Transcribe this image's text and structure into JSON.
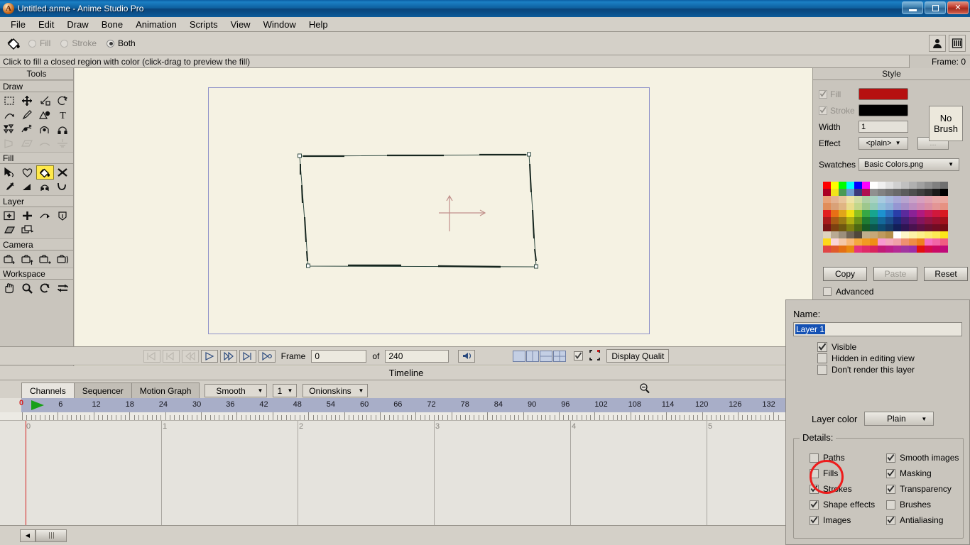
{
  "window": {
    "title": "Untitled.anme - Anime Studio Pro",
    "app_icon": "anime-studio-logo-icon",
    "minimize_label": "minimize-icon",
    "restore_label": "restore-icon",
    "close_label": "✕"
  },
  "menu": {
    "items": [
      "File",
      "Edit",
      "Draw",
      "Bone",
      "Animation",
      "Scripts",
      "View",
      "Window",
      "Help"
    ]
  },
  "modebar": {
    "tool_icon": "paint-bucket-icon",
    "options": [
      {
        "label": "Fill",
        "selected": false,
        "disabled": true
      },
      {
        "label": "Stroke",
        "selected": false,
        "disabled": true
      },
      {
        "label": "Both",
        "selected": true,
        "disabled": false
      }
    ],
    "right_icons": [
      "user-account-icon",
      "content-library-icon"
    ]
  },
  "statusbar": {
    "hint": "Click to fill a closed region with color (click-drag to preview the fill)",
    "frame_indicator": "Frame: 0"
  },
  "tools": {
    "panel_title": "Tools",
    "groups": [
      {
        "name": "Draw",
        "items": [
          {
            "name": "select-points-tool",
            "glyph": "dashed-rect",
            "enabled": true,
            "selected": false
          },
          {
            "name": "transform-points-tool",
            "glyph": "move-arrows",
            "enabled": true,
            "selected": false
          },
          {
            "name": "scale-points-tool",
            "glyph": "scale-box",
            "enabled": true,
            "selected": false
          },
          {
            "name": "rotate-points-tool",
            "glyph": "rotate-arrow",
            "enabled": true,
            "selected": false
          },
          {
            "name": "curvature-tool",
            "glyph": "arc",
            "enabled": true,
            "selected": false
          },
          {
            "name": "add-point-tool",
            "glyph": "pencil",
            "enabled": true,
            "selected": false
          },
          {
            "name": "freehand-tool",
            "glyph": "shape-circle",
            "enabled": true,
            "selected": false
          },
          {
            "name": "text-tool",
            "glyph": "letter-T",
            "enabled": true,
            "selected": false
          },
          {
            "name": "magnet-tool",
            "glyph": "triangles",
            "enabled": true,
            "selected": false
          },
          {
            "name": "noise-tool",
            "glyph": "curve-node",
            "enabled": true,
            "selected": false
          },
          {
            "name": "bind-points-tool",
            "glyph": "arch",
            "enabled": true,
            "selected": false
          },
          {
            "name": "hide-edge-tool",
            "glyph": "magnet",
            "enabled": true,
            "selected": false
          },
          {
            "name": "perspective-points-tool",
            "glyph": "trapezoid",
            "enabled": false,
            "selected": false
          },
          {
            "name": "shear-points-tool",
            "glyph": "shear",
            "enabled": false,
            "selected": false
          },
          {
            "name": "bend-points-tool",
            "glyph": "bend",
            "enabled": false,
            "selected": false
          },
          {
            "name": "reset-tool",
            "glyph": "reset-lines",
            "enabled": false,
            "selected": false
          }
        ]
      },
      {
        "name": "Fill",
        "items": [
          {
            "name": "select-shape-tool",
            "glyph": "arrow-shape",
            "enabled": true,
            "selected": false
          },
          {
            "name": "create-shape-tool",
            "glyph": "blob",
            "enabled": true,
            "selected": false
          },
          {
            "name": "paint-bucket-tool",
            "glyph": "paint-bucket",
            "enabled": true,
            "selected": true
          },
          {
            "name": "delete-shape-tool",
            "glyph": "x-mark",
            "enabled": true,
            "selected": false
          },
          {
            "name": "eyedropper-tool",
            "glyph": "eyedropper",
            "enabled": true,
            "selected": false
          },
          {
            "name": "gradient-tool",
            "glyph": "gradient-wedge",
            "enabled": true,
            "selected": false
          },
          {
            "name": "line-width-tool",
            "glyph": "arch-width",
            "enabled": true,
            "selected": false
          },
          {
            "name": "hide-edge-fill-tool",
            "glyph": "curve-hook",
            "enabled": true,
            "selected": false
          }
        ]
      },
      {
        "name": "Layer",
        "items": [
          {
            "name": "layer-transform-tool",
            "glyph": "layer-move",
            "enabled": true,
            "selected": false
          },
          {
            "name": "layer-translate-tool",
            "glyph": "plus-cross",
            "enabled": true,
            "selected": false
          },
          {
            "name": "layer-rotate-z-tool",
            "glyph": "rotate-z",
            "enabled": true,
            "selected": false
          },
          {
            "name": "layer-rotate-xy-tool",
            "glyph": "rotate-xy",
            "enabled": true,
            "selected": false
          },
          {
            "name": "layer-shear-tool",
            "glyph": "shear-layer",
            "enabled": true,
            "selected": false
          },
          {
            "name": "set-origin-tool",
            "glyph": "stack-layers",
            "enabled": true,
            "selected": false
          }
        ]
      },
      {
        "name": "Camera",
        "items": [
          {
            "name": "track-camera-tool",
            "glyph": "camera-track",
            "enabled": true,
            "selected": false
          },
          {
            "name": "zoom-camera-tool",
            "glyph": "camera-zoom",
            "enabled": true,
            "selected": false
          },
          {
            "name": "roll-camera-tool",
            "glyph": "camera-roll",
            "enabled": true,
            "selected": false
          },
          {
            "name": "pan-tilt-camera-tool",
            "glyph": "camera-pan",
            "enabled": true,
            "selected": false
          }
        ]
      },
      {
        "name": "Workspace",
        "items": [
          {
            "name": "pan-workspace-tool",
            "glyph": "hand",
            "enabled": true,
            "selected": false
          },
          {
            "name": "zoom-workspace-tool",
            "glyph": "magnifier",
            "enabled": true,
            "selected": false
          },
          {
            "name": "rotate-workspace-tool",
            "glyph": "rotate-ws",
            "enabled": true,
            "selected": false
          },
          {
            "name": "orbit-workspace-tool",
            "glyph": "orbit",
            "enabled": true,
            "selected": false
          }
        ]
      }
    ]
  },
  "canvas": {
    "background_color": "#f5f2e3",
    "frame_border_color": "#8f92c9",
    "shape_stroke_color": "#2f4a41",
    "origin_marker_color": "#c08f8a"
  },
  "playback": {
    "buttons": [
      {
        "name": "jump-to-start-button",
        "glyph": "skip-start",
        "enabled": false
      },
      {
        "name": "step-back-button",
        "glyph": "step-back",
        "enabled": false
      },
      {
        "name": "rewind-button",
        "glyph": "rewind",
        "enabled": false
      },
      {
        "name": "play-button",
        "glyph": "play",
        "enabled": true
      },
      {
        "name": "fast-forward-button",
        "glyph": "fast-forward",
        "enabled": true
      },
      {
        "name": "step-forward-button",
        "glyph": "step-forward",
        "enabled": true
      },
      {
        "name": "jump-to-end-button",
        "glyph": "skip-end",
        "enabled": true
      }
    ],
    "frame_label": "Frame",
    "frame_value": "0",
    "of_label": "of",
    "total_frames": "240",
    "audio_icon": "speaker-icon",
    "layout_buttons": [
      "single-view",
      "two-column-view",
      "two-row-view",
      "quad-view"
    ],
    "show_frame_checked": true,
    "crop_icon": "crop-marks-icon",
    "display_quality_label": "Display Qualit"
  },
  "timeline": {
    "title": "Timeline",
    "tabs": [
      {
        "label": "Channels",
        "active": true
      },
      {
        "label": "Sequencer",
        "active": false
      },
      {
        "label": "Motion Graph",
        "active": false
      }
    ],
    "dropdowns": [
      {
        "name": "interpolation-dropdown",
        "value": "Smooth"
      },
      {
        "name": "keyframe-step-dropdown",
        "value": "1"
      },
      {
        "name": "onionskins-dropdown",
        "value": "Onionskins"
      }
    ],
    "zoom_out_icon": "zoom-out-icon",
    "ruler_ticks": [
      0,
      6,
      12,
      18,
      24,
      30,
      36,
      42,
      48,
      54,
      60,
      66,
      72,
      78,
      84,
      90,
      96,
      102,
      108,
      114,
      120,
      126,
      132
    ],
    "playhead_frame": "0",
    "second_markers": [
      "0",
      "1",
      "2",
      "3",
      "4",
      "5"
    ],
    "scroll_left_icon": "scroll-left-arrow-icon"
  },
  "style": {
    "panel_title": "Style",
    "fill": {
      "label": "Fill",
      "checked": true,
      "disabled": true,
      "color": "#b61010"
    },
    "stroke": {
      "label": "Stroke",
      "checked": true,
      "disabled": true,
      "color": "#000000"
    },
    "width": {
      "label": "Width",
      "value": "1"
    },
    "effect": {
      "label": "Effect",
      "value": "<plain>",
      "more_label": "..."
    },
    "no_brush_line1": "No",
    "no_brush_line2": "Brush",
    "swatches": {
      "label": "Swatches",
      "value": "Basic Colors.png"
    },
    "buttons": [
      {
        "label": "Copy",
        "enabled": true
      },
      {
        "label": "Paste",
        "enabled": false
      },
      {
        "label": "Reset",
        "enabled": true
      }
    ],
    "advanced": {
      "label": "Advanced",
      "checked": false
    },
    "swatch_colors": [
      "#fe0000",
      "#fefe00",
      "#00fe00",
      "#00fefe",
      "#0000fe",
      "#fe00fe",
      "#ffffff",
      "#f0f0f0",
      "#e0e0e0",
      "#d0d0d0",
      "#c0c0c0",
      "#b0b0b0",
      "#a0a0a0",
      "#909090",
      "#808080",
      "#707070",
      "#aa0022",
      "#f2e41a",
      "#4a9a55",
      "#6f9bd0",
      "#3a3a7a",
      "#b01050",
      "#909090",
      "#828282",
      "#757575",
      "#6a6a6a",
      "#5c5c5c",
      "#4e4e4e",
      "#3f3f3f",
      "#303030",
      "#1a1a1a",
      "#000000",
      "#e8a377",
      "#e3b291",
      "#e8c49a",
      "#eee3a5",
      "#cfdca2",
      "#aecfa5",
      "#a8d2c2",
      "#a7cbe0",
      "#a6b9dd",
      "#a9a9d8",
      "#b7a4cf",
      "#c9a2c8",
      "#d79fbf",
      "#e0a0b0",
      "#e7a7a7",
      "#eaa9a0",
      "#e08e5a",
      "#d9a178",
      "#e0b583",
      "#e9dc8c",
      "#c2d68b",
      "#9dc78d",
      "#93cbb6",
      "#8fc0da",
      "#8fb0d8",
      "#9596d2",
      "#a68ec6",
      "#bd8ec0",
      "#ce8bb4",
      "#d98da3",
      "#e39595",
      "#e69282",
      "#e21f1f",
      "#e86f16",
      "#e0a51a",
      "#f0e010",
      "#8fc020",
      "#36a845",
      "#17a58f",
      "#1d92cf",
      "#2a6cbb",
      "#2a3ea8",
      "#5b2a9c",
      "#8b2296",
      "#b01a80",
      "#c41a5c",
      "#d0183c",
      "#d81a22",
      "#a81b1b",
      "#a85a14",
      "#9a7a14",
      "#b0b012",
      "#6b9018",
      "#1f7c33",
      "#10786a",
      "#14699a",
      "#1c4d8a",
      "#1b2c7c",
      "#421f74",
      "#661a6e",
      "#83155e",
      "#911544",
      "#9c1130",
      "#a2111b",
      "#7a1414",
      "#7c4110",
      "#6f5810",
      "#80800f",
      "#4d6812",
      "#165a26",
      "#0c564c",
      "#0d4b70",
      "#143864",
      "#131f58",
      "#2f1554",
      "#4a124f",
      "#5e1044",
      "#680f31",
      "#720c23",
      "#760c13",
      "#ded3bd",
      "#b9aa93",
      "#9c8f7c",
      "#6f6455",
      "#50473b",
      "#c0ae8d",
      "#c7a878",
      "#c09a5e",
      "#b58e4a",
      "#ffffff",
      "#fdf6c8",
      "#fdf3a8",
      "#fdf08c",
      "#fded70",
      "#fdea54",
      "#fce71a",
      "#fdd81a",
      "#fad6d8",
      "#f4c8a8",
      "#f7b878",
      "#f5a83e",
      "#f29a22",
      "#ef8f14",
      "#f79ad0",
      "#f3a6bb",
      "#f0a0a8",
      "#ef9070",
      "#ee8c46",
      "#ef7f1e",
      "#f46fc0",
      "#f265a6",
      "#f05c82",
      "#e04646",
      "#e05a2c",
      "#e47014",
      "#e88a10",
      "#e6337a",
      "#e02a68",
      "#d9245c",
      "#c21b76",
      "#bd1f88",
      "#b52a96",
      "#a235a0",
      "#9e2ea8",
      "#e21010",
      "#d60c4a",
      "#ca0a66",
      "#c00a7a"
    ]
  },
  "layer_dialog": {
    "name_label": "Name:",
    "name_value": "Layer 1",
    "checkboxes": [
      {
        "label": "Visible",
        "checked": true
      },
      {
        "label": "Hidden in editing view",
        "checked": false
      },
      {
        "label": "Don't render this layer",
        "checked": false
      }
    ],
    "layer_color_label": "Layer color",
    "layer_color_value": "Plain",
    "details_label": "Details:",
    "details": [
      {
        "label": "Paths",
        "checked": false,
        "highlighted": false
      },
      {
        "label": "Smooth images",
        "checked": true,
        "highlighted": false
      },
      {
        "label": "Fills",
        "checked": false,
        "highlighted": true
      },
      {
        "label": "Masking",
        "checked": true,
        "highlighted": false
      },
      {
        "label": "Strokes",
        "checked": true,
        "highlighted": false
      },
      {
        "label": "Transparency",
        "checked": true,
        "highlighted": false
      },
      {
        "label": "Shape effects",
        "checked": true,
        "highlighted": false
      },
      {
        "label": "Brushes",
        "checked": false,
        "highlighted": false
      },
      {
        "label": "Images",
        "checked": true,
        "highlighted": false
      },
      {
        "label": "Antialiasing",
        "checked": true,
        "highlighted": false
      }
    ],
    "annotation_color": "#ee1c1c"
  }
}
